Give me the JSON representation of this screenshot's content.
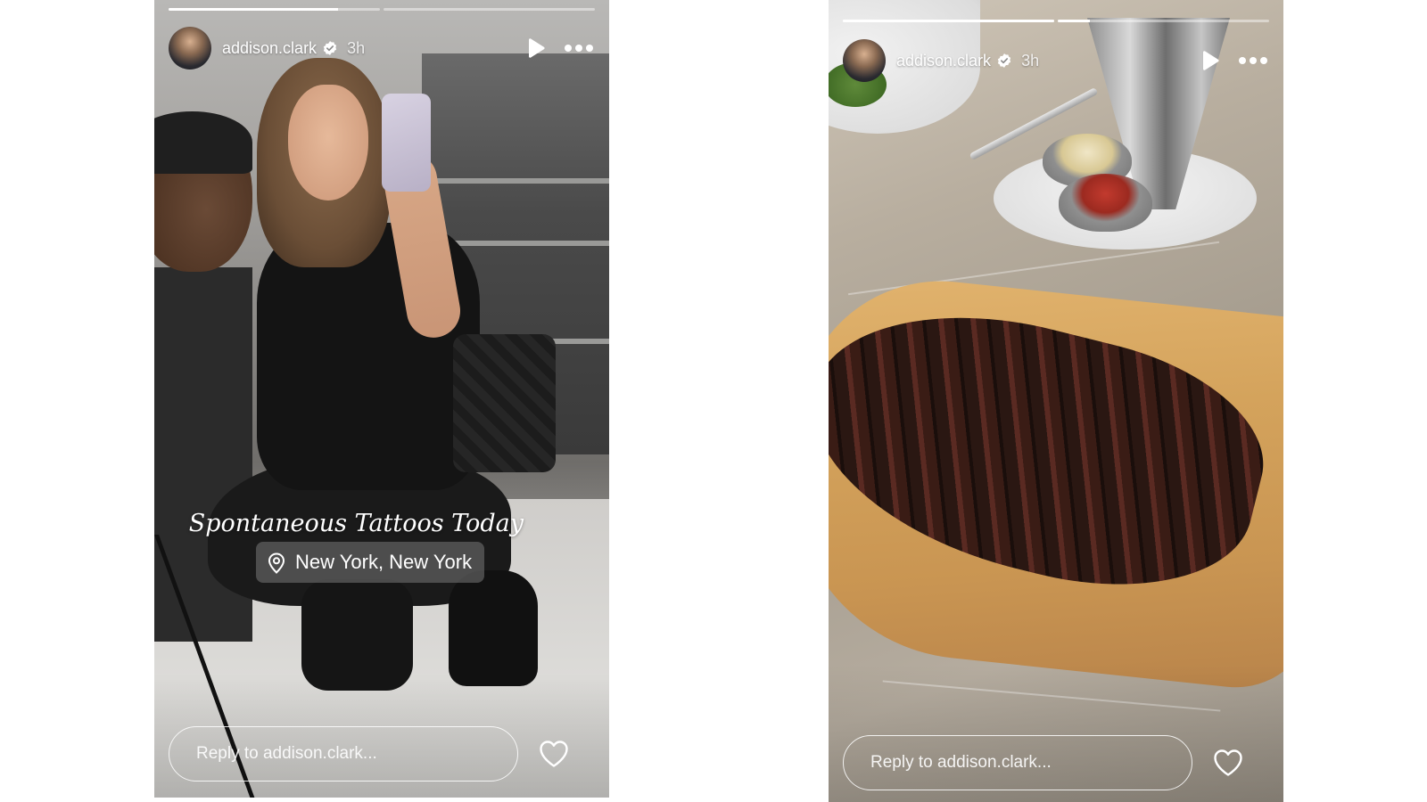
{
  "stories": [
    {
      "progress": [
        0.8,
        0
      ],
      "username": "addison.clark",
      "timestamp": "3h",
      "caption": "Spontaneous Tattoos Today",
      "location": "New York, New York",
      "reply_placeholder": "Reply to addison.clark...",
      "icons": {
        "verified": "verified-badge-icon",
        "play": "play-icon",
        "more": "more-options-icon",
        "location": "location-pin-icon",
        "like": "heart-icon"
      }
    },
    {
      "progress": [
        1,
        0.15
      ],
      "username": "addison.clark",
      "timestamp": "3h",
      "reply_placeholder": "Reply to addison.clark...",
      "icons": {
        "verified": "verified-badge-icon",
        "play": "play-icon",
        "more": "more-options-icon",
        "like": "heart-icon"
      }
    }
  ],
  "colors": {
    "text": "#ffffff",
    "page_background": "#ffffff"
  }
}
